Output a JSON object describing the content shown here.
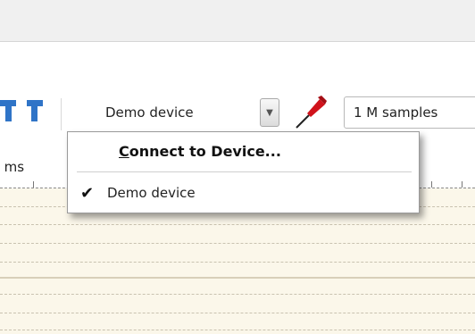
{
  "toolbar": {
    "device_label": "Demo device",
    "samples_value": "1 M samples",
    "icons": [
      "cursor-pair-icon",
      "dropdown-arrow-icon",
      "probe-icon"
    ]
  },
  "ruler": {
    "time_label": ") ms"
  },
  "device_menu": {
    "connect_item": "Connect to Device...",
    "connect_mnemonic": "C",
    "devices": [
      {
        "label": "Demo device",
        "checked": true,
        "check_glyph": "✔"
      }
    ]
  },
  "colors": {
    "accent_blue": "#2f74c7",
    "probe_red": "#d0121b",
    "trace_bg": "#fbf7ea"
  }
}
